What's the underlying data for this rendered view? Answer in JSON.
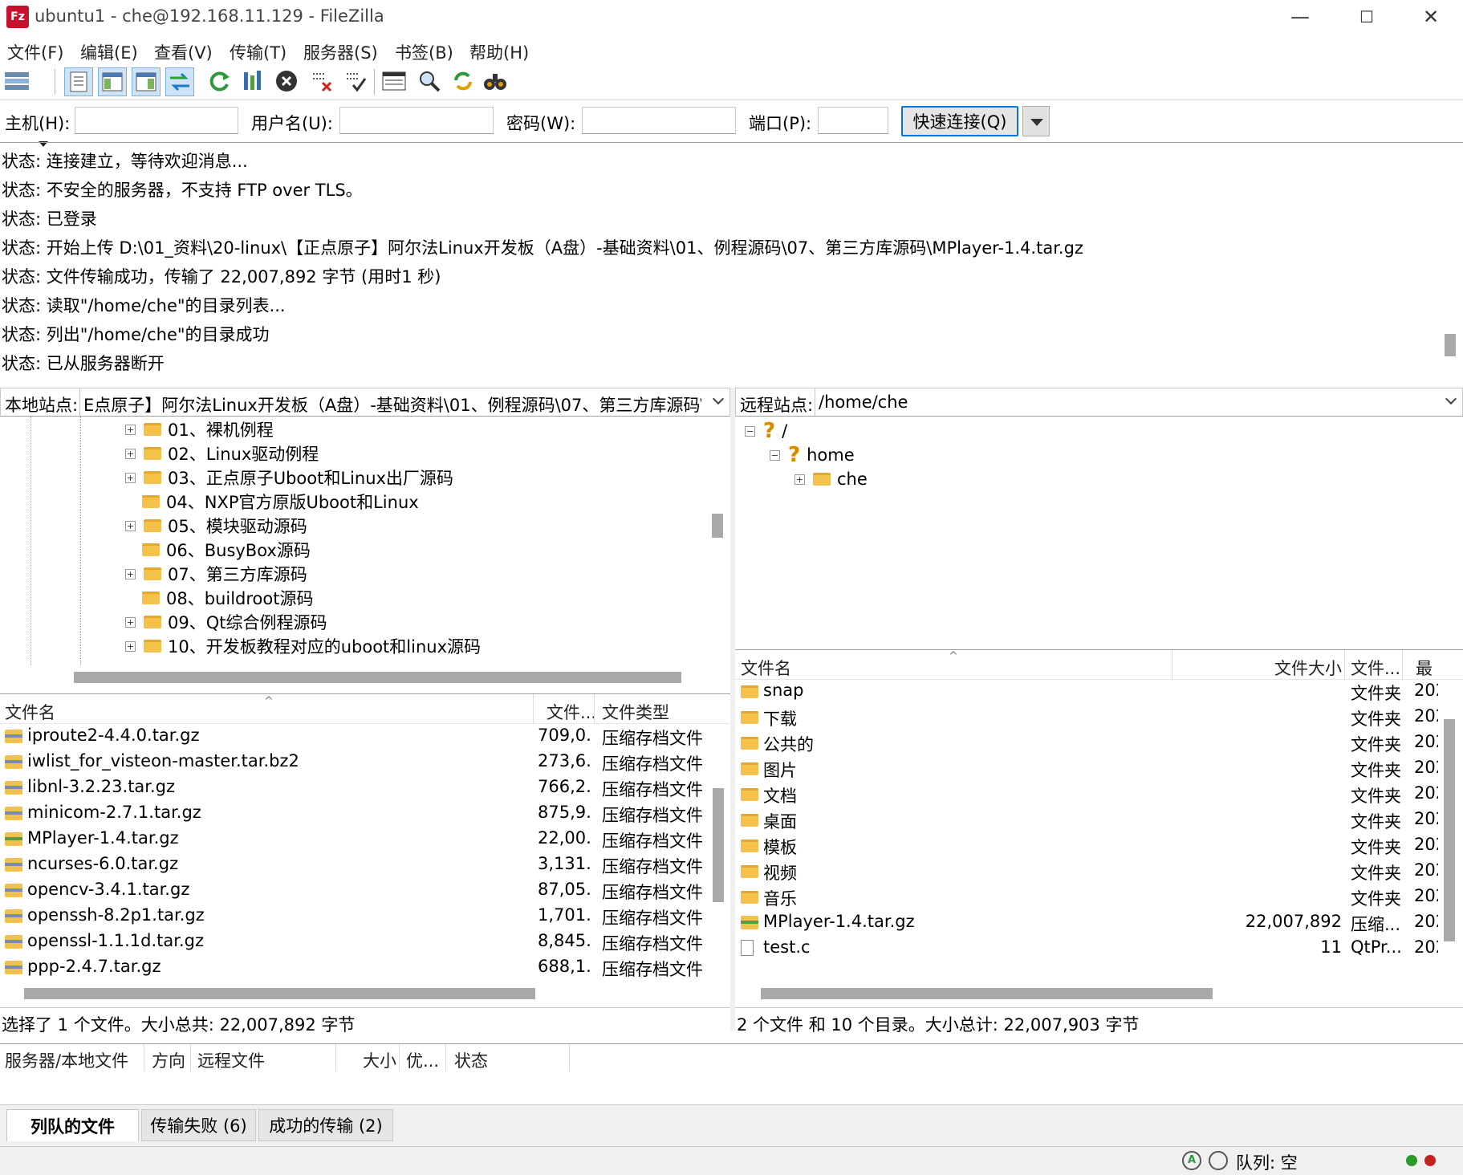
{
  "window": {
    "title": "ubuntu1 - che@192.168.11.129 - FileZilla",
    "app_icon": "Fz",
    "minimize": "—",
    "maximize": "☐",
    "close": "✕"
  },
  "menu": [
    "文件(F)",
    "编辑(E)",
    "查看(V)",
    "传输(T)",
    "服务器(S)",
    "书签(B)",
    "帮助(H)"
  ],
  "toolbar_icons": [
    "site-manager-icon",
    "toggle-message-log-icon",
    "toggle-local-tree-icon",
    "toggle-remote-tree-icon",
    "toggle-queue-icon",
    "refresh-icon",
    "process-queue-icon",
    "cancel-icon",
    "disconnect-icon",
    "reconnect-icon",
    "directory-listing-filters-icon",
    "toggle-comparison-icon",
    "sync-browsing-icon",
    "search-icon"
  ],
  "quickconnect": {
    "host_label": "主机(H):",
    "user_label": "用户名(U):",
    "pass_label": "密码(W):",
    "port_label": "端口(P):",
    "host_value": "",
    "user_value": "",
    "pass_value": "",
    "port_value": "",
    "button": "快速连接(Q)"
  },
  "log": [
    "状态: 连接建立，等待欢迎消息...",
    "状态: 不安全的服务器，不支持 FTP over TLS。",
    "状态: 已登录",
    "状态: 开始上传 D:\\01_资料\\20-linux\\【正点原子】阿尔法Linux开发板（A盘）-基础资料\\01、例程源码\\07、第三方库源码\\MPlayer-1.4.tar.gz",
    "状态: 文件传输成功，传输了 22,007,892 字节 (用时1 秒)",
    "状态: 读取\"/home/che\"的目录列表...",
    "状态: 列出\"/home/che\"的目录成功",
    "状态: 已从服务器断开"
  ],
  "local": {
    "site_label": "本地站点:",
    "path": "E点原子】阿尔法Linux开发板（A盘）-基础资料\\01、例程源码\\07、第三方库源码\\",
    "tree": [
      {
        "label": "01、裸机例程",
        "expandable": true
      },
      {
        "label": "02、Linux驱动例程",
        "expandable": true
      },
      {
        "label": "03、正点原子Uboot和Linux出厂源码",
        "expandable": true
      },
      {
        "label": "04、NXP官方原版Uboot和Linux",
        "expandable": false
      },
      {
        "label": "05、模块驱动源码",
        "expandable": true
      },
      {
        "label": "06、BusyBox源码",
        "expandable": false
      },
      {
        "label": "07、第三方库源码",
        "expandable": true
      },
      {
        "label": "08、buildroot源码",
        "expandable": false
      },
      {
        "label": "09、Qt综合例程源码",
        "expandable": true
      },
      {
        "label": "10、开发板教程对应的uboot和linux源码",
        "expandable": true
      }
    ],
    "columns": {
      "name": "文件名",
      "size": "文件...",
      "type": "文件类型"
    },
    "files": [
      {
        "name": "iproute2-4.4.0.tar.gz",
        "size": "709,0...",
        "type": "压缩存档文件",
        "icon": "archive-icon"
      },
      {
        "name": "iwlist_for_visteon-master.tar.bz2",
        "size": "273,6...",
        "type": "压缩存档文件",
        "icon": "archive-icon"
      },
      {
        "name": "libnl-3.2.23.tar.gz",
        "size": "766,2...",
        "type": "压缩存档文件",
        "icon": "archive-icon"
      },
      {
        "name": "minicom-2.7.1.tar.gz",
        "size": "875,9...",
        "type": "压缩存档文件",
        "icon": "archive-icon"
      },
      {
        "name": "MPlayer-1.4.tar.gz",
        "size": "22,00...",
        "type": "压缩存档文件",
        "icon": "archive-icon"
      },
      {
        "name": "ncurses-6.0.tar.gz",
        "size": "3,131...",
        "type": "压缩存档文件",
        "icon": "archive-icon"
      },
      {
        "name": "opencv-3.4.1.tar.gz",
        "size": "87,05...",
        "type": "压缩存档文件",
        "icon": "archive-icon"
      },
      {
        "name": "openssh-8.2p1.tar.gz",
        "size": "1,701...",
        "type": "压缩存档文件",
        "icon": "archive-icon"
      },
      {
        "name": "openssl-1.1.1d.tar.gz",
        "size": "8,845...",
        "type": "压缩存档文件",
        "icon": "archive-icon"
      },
      {
        "name": "ppp-2.4.7.tar.gz",
        "size": "688,1...",
        "type": "压缩存档文件",
        "icon": "archive-icon"
      }
    ],
    "status": "选择了 1 个文件。大小总共: 22,007,892 字节"
  },
  "remote": {
    "site_label": "远程站点:",
    "path": "/home/che",
    "tree": [
      {
        "label": "/",
        "depth": 0
      },
      {
        "label": "home",
        "depth": 1
      },
      {
        "label": "che",
        "depth": 2
      }
    ],
    "columns": {
      "name": "文件名",
      "size": "文件大小",
      "type": "文件...",
      "modified": "最"
    },
    "files": [
      {
        "name": "snap",
        "size": "",
        "type": "文件夹",
        "modified": "202"
      },
      {
        "name": "下载",
        "size": "",
        "type": "文件夹",
        "modified": "202"
      },
      {
        "name": "公共的",
        "size": "",
        "type": "文件夹",
        "modified": "202"
      },
      {
        "name": "图片",
        "size": "",
        "type": "文件夹",
        "modified": "202"
      },
      {
        "name": "文档",
        "size": "",
        "type": "文件夹",
        "modified": "202"
      },
      {
        "name": "桌面",
        "size": "",
        "type": "文件夹",
        "modified": "202"
      },
      {
        "name": "模板",
        "size": "",
        "type": "文件夹",
        "modified": "202"
      },
      {
        "name": "视频",
        "size": "",
        "type": "文件夹",
        "modified": "202"
      },
      {
        "name": "音乐",
        "size": "",
        "type": "文件夹",
        "modified": "202"
      },
      {
        "name": "MPlayer-1.4.tar.gz",
        "size": "22,007,892",
        "type": "压缩...",
        "modified": "202"
      },
      {
        "name": "test.c",
        "size": "11",
        "type": "QtPr...",
        "modified": "202"
      }
    ],
    "status": "2 个文件 和 10 个目录。大小总计: 22,007,903 字节"
  },
  "queue": {
    "columns": [
      "服务器/本地文件",
      "方向",
      "远程文件",
      "大小",
      "优...",
      "状态"
    ],
    "tabs": [
      "列队的文件",
      "传输失败 (6)",
      "成功的传输 (2)"
    ],
    "status": "队列: 空"
  }
}
